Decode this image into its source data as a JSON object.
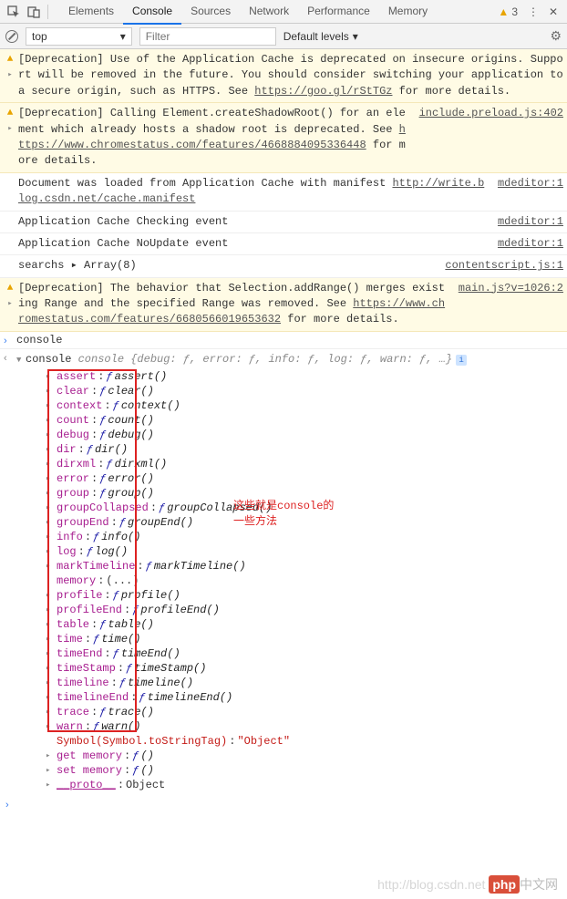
{
  "tabs": {
    "items": [
      "Elements",
      "Console",
      "Sources",
      "Network",
      "Performance",
      "Memory"
    ],
    "active": "Console"
  },
  "warnCount": "3",
  "filter": {
    "context": "top",
    "placeholder": "Filter",
    "levels": "Default levels"
  },
  "messages": [
    {
      "type": "warn",
      "arrow": true,
      "text": "[Deprecation] Use of the Application Cache is deprecated on insecure origins. Support will be removed in the future. You should consider switching your application to a secure origin, such as HTTPS. See ",
      "link": "https://goo.gl/rStTGz",
      "after": " for more details."
    },
    {
      "type": "warn",
      "arrow": true,
      "text": "[Deprecation] Calling Element.createShadowRoot() for an element which already hosts a shadow root is deprecated. See ",
      "link": "https://www.chromestatus.com/features/4668884095336448",
      "after": " for more details.",
      "src": "include.preload.js:402"
    },
    {
      "type": "plain",
      "text": "Document was loaded from Application Cache with manifest ",
      "link": "http://write.blog.csdn.net/cache.manifest",
      "src": "mdeditor:1"
    },
    {
      "type": "plain",
      "text": "Application Cache Checking event",
      "src": "mdeditor:1"
    },
    {
      "type": "plain",
      "text": "Application Cache NoUpdate event",
      "src": "mdeditor:1"
    },
    {
      "type": "plain",
      "text": "searchs   ▸ Array(8)",
      "src": "contentscript.js:1"
    },
    {
      "type": "warn",
      "arrow": true,
      "text": "[Deprecation] The behavior that Selection.addRange() merges existing Range and the specified Range was removed. See ",
      "link": "https://www.chromestatus.com/features/6680566019653632",
      "after": " for more details.",
      "src": "main.js?v=1026:2"
    }
  ],
  "prompt": {
    "input": "console",
    "summary": "console {debug: ƒ, error: ƒ, info: ƒ, log: ƒ, warn: ƒ, …}"
  },
  "props": [
    {
      "n": "assert",
      "v": "assert()"
    },
    {
      "n": "clear",
      "v": "clear()"
    },
    {
      "n": "context",
      "v": "context()"
    },
    {
      "n": "count",
      "v": "count()"
    },
    {
      "n": "debug",
      "v": "debug()"
    },
    {
      "n": "dir",
      "v": "dir()"
    },
    {
      "n": "dirxml",
      "v": "dirxml()"
    },
    {
      "n": "error",
      "v": "error()"
    },
    {
      "n": "group",
      "v": "group()"
    },
    {
      "n": "groupCollapsed",
      "v": "groupCollapsed()"
    },
    {
      "n": "groupEnd",
      "v": "groupEnd()"
    },
    {
      "n": "info",
      "v": "info()"
    },
    {
      "n": "log",
      "v": "log()"
    },
    {
      "n": "markTimeline",
      "v": "markTimeline()"
    },
    {
      "n": "memory",
      "v": "(...)",
      "plain": true
    },
    {
      "n": "profile",
      "v": "profile()"
    },
    {
      "n": "profileEnd",
      "v": "profileEnd()"
    },
    {
      "n": "table",
      "v": "table()"
    },
    {
      "n": "time",
      "v": "time()"
    },
    {
      "n": "timeEnd",
      "v": "timeEnd()"
    },
    {
      "n": "timeStamp",
      "v": "timeStamp()"
    },
    {
      "n": "timeline",
      "v": "timeline()"
    },
    {
      "n": "timelineEnd",
      "v": "timelineEnd()"
    },
    {
      "n": "trace",
      "v": "trace()"
    },
    {
      "n": "warn",
      "v": "warn()"
    }
  ],
  "tail": [
    {
      "n": "Symbol(Symbol.toStringTag)",
      "v": "\"Object\"",
      "sym": true
    },
    {
      "n": "get memory",
      "v": "()",
      "fn": true,
      "arrow": true
    },
    {
      "n": "set memory",
      "v": "()",
      "fn": true,
      "arrow": true
    },
    {
      "n": "__proto__",
      "v": "Object",
      "arrow": true,
      "under": true
    }
  ],
  "annotation": {
    "l1": "这些就是console的",
    "l2": "一些方法"
  },
  "watermark": {
    "url": "http://blog.csdn.net",
    "b1": "php",
    "b2": "中文网"
  }
}
